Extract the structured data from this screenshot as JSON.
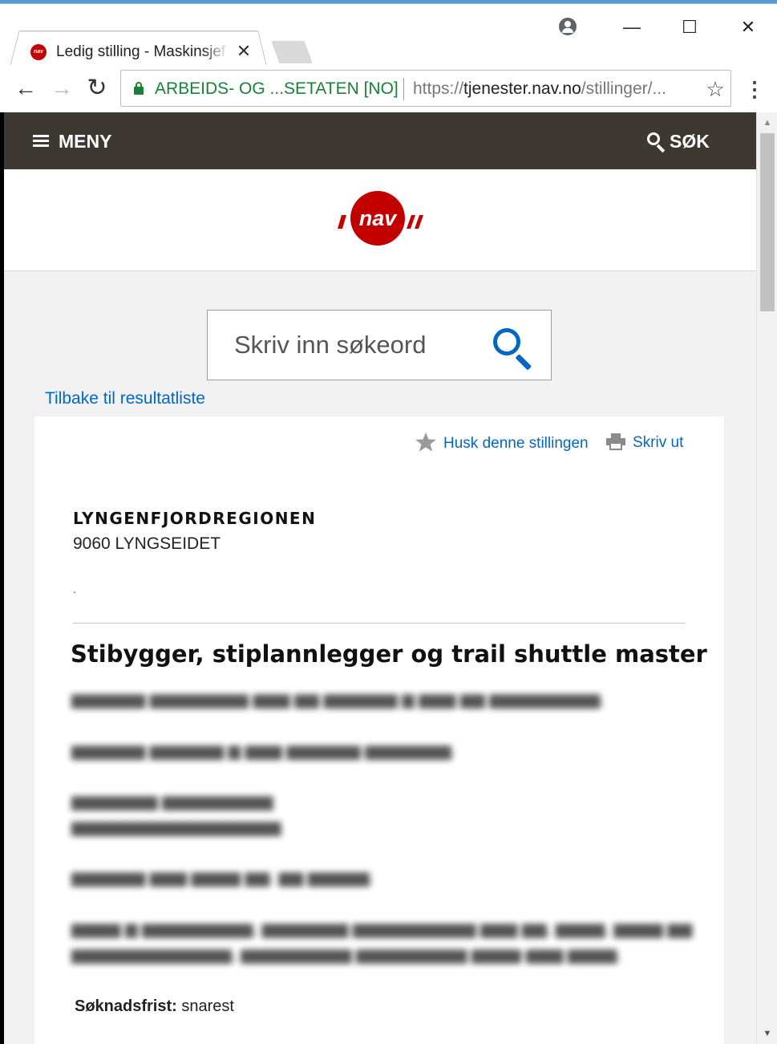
{
  "browser": {
    "tab_title": "Ledig stilling - Maskinsjef",
    "tab_close": "✕",
    "window_controls": {
      "minimize": "—",
      "maximize": "☐",
      "close": "✕"
    },
    "nav": {
      "back": "←",
      "forward": "→",
      "reload": "↻"
    },
    "ev_name": "ARBEIDS- OG ...SETATEN [NO]",
    "url_prefix": "https://",
    "url_host": "tjenester.nav.no",
    "url_path": "/stillinger/...",
    "bookmark_star": "☆",
    "menu_dots": "⋮"
  },
  "navbar": {
    "menu_label": "MENY",
    "search_label": "SØK"
  },
  "search": {
    "placeholder": "Skriv inn søkeord"
  },
  "back_link": "Tilbake til resultatliste",
  "actions": {
    "remember": "Husk denne stillingen",
    "print": "Skriv ut"
  },
  "listing": {
    "employer": "LYNGENFJORDREGIONEN",
    "location": "9060 LYNGSEIDET",
    "dot": ".",
    "title": "Stibygger, stiplannlegger og trail shuttle master",
    "deadline_label": "Søknadsfrist:",
    "deadline_value": " snarest"
  },
  "colors": {
    "nav_red": "#c30000",
    "navbar_bg": "#3e3832",
    "link_blue": "#0067c5",
    "ev_green": "#188038"
  },
  "scrollbar": {
    "up": "▲",
    "down": "▼"
  }
}
